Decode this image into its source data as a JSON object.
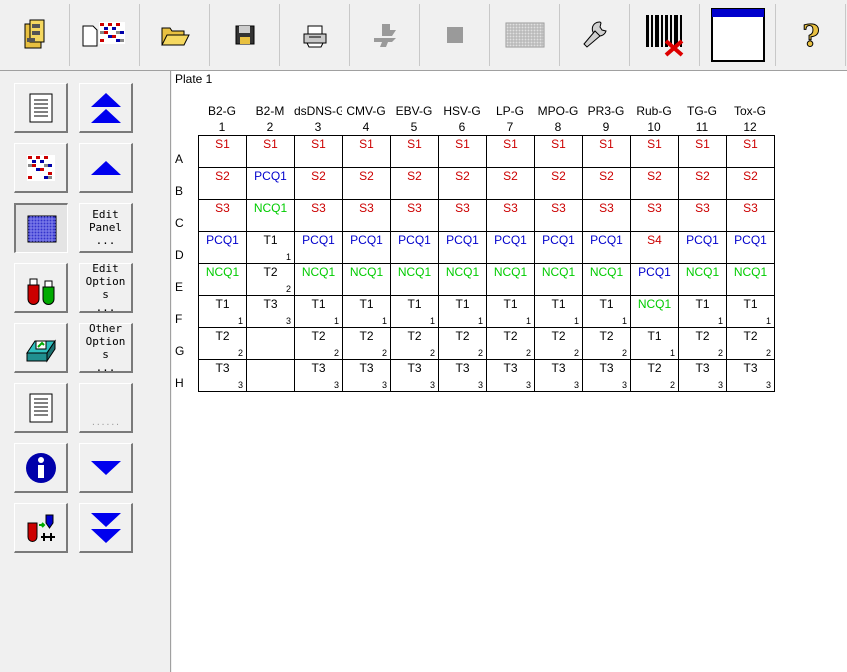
{
  "toolbar": {
    "buttons": [
      {
        "name": "open-database-icon"
      },
      {
        "name": "new-layout-icon"
      },
      {
        "name": "open-folder-icon"
      },
      {
        "name": "save-disk-icon"
      },
      {
        "name": "print-icon"
      },
      {
        "name": "transfer-icon",
        "disabled": true
      },
      {
        "name": "stop-icon",
        "disabled": true
      },
      {
        "name": "plate-grid-icon",
        "disabled": true
      },
      {
        "name": "wrench-icon"
      },
      {
        "name": "barcode-delete-icon"
      },
      {
        "name": "window-icon"
      },
      {
        "name": "help-icon"
      }
    ]
  },
  "left": {
    "edit_panel_label": "Edit\nPanel\n...",
    "edit_options_label": "Edit\nOption\ns\n...",
    "other_options_label": "Other\nOption\ns\n...",
    "disabled_label": "......"
  },
  "plate": {
    "title": "Plate 1",
    "columns": [
      {
        "name": "B2-G",
        "num": "1"
      },
      {
        "name": "B2-M",
        "num": "2"
      },
      {
        "name": "dsDNS-G",
        "num": "3"
      },
      {
        "name": "CMV-G",
        "num": "4"
      },
      {
        "name": "EBV-G",
        "num": "5"
      },
      {
        "name": "HSV-G",
        "num": "6"
      },
      {
        "name": "LP-G",
        "num": "7"
      },
      {
        "name": "MPO-G",
        "num": "8"
      },
      {
        "name": "PR3-G",
        "num": "9"
      },
      {
        "name": "Rub-G",
        "num": "10"
      },
      {
        "name": "TG-G",
        "num": "11"
      },
      {
        "name": "Tox-G",
        "num": "12"
      }
    ],
    "rows": [
      "A",
      "B",
      "C",
      "D",
      "E",
      "F",
      "G",
      "H"
    ],
    "colors": {
      "S": "#cc0000",
      "PCQ": "#0000cc",
      "NCQ": "#00cc00",
      "T": "#000000"
    },
    "wells": [
      [
        {
          "l": "S1",
          "t": "S"
        },
        {
          "l": "S1",
          "t": "S"
        },
        {
          "l": "S1",
          "t": "S"
        },
        {
          "l": "S1",
          "t": "S"
        },
        {
          "l": "S1",
          "t": "S"
        },
        {
          "l": "S1",
          "t": "S"
        },
        {
          "l": "S1",
          "t": "S"
        },
        {
          "l": "S1",
          "t": "S"
        },
        {
          "l": "S1",
          "t": "S"
        },
        {
          "l": "S1",
          "t": "S"
        },
        {
          "l": "S1",
          "t": "S"
        },
        {
          "l": "S1",
          "t": "S"
        }
      ],
      [
        {
          "l": "S2",
          "t": "S"
        },
        {
          "l": "PCQ1",
          "t": "PCQ"
        },
        {
          "l": "S2",
          "t": "S"
        },
        {
          "l": "S2",
          "t": "S"
        },
        {
          "l": "S2",
          "t": "S"
        },
        {
          "l": "S2",
          "t": "S"
        },
        {
          "l": "S2",
          "t": "S"
        },
        {
          "l": "S2",
          "t": "S"
        },
        {
          "l": "S2",
          "t": "S"
        },
        {
          "l": "S2",
          "t": "S"
        },
        {
          "l": "S2",
          "t": "S"
        },
        {
          "l": "S2",
          "t": "S"
        }
      ],
      [
        {
          "l": "S3",
          "t": "S"
        },
        {
          "l": "NCQ1",
          "t": "NCQ"
        },
        {
          "l": "S3",
          "t": "S"
        },
        {
          "l": "S3",
          "t": "S"
        },
        {
          "l": "S3",
          "t": "S"
        },
        {
          "l": "S3",
          "t": "S"
        },
        {
          "l": "S3",
          "t": "S"
        },
        {
          "l": "S3",
          "t": "S"
        },
        {
          "l": "S3",
          "t": "S"
        },
        {
          "l": "S3",
          "t": "S"
        },
        {
          "l": "S3",
          "t": "S"
        },
        {
          "l": "S3",
          "t": "S"
        }
      ],
      [
        {
          "l": "PCQ1",
          "t": "PCQ"
        },
        {
          "l": "T1",
          "t": "T",
          "r": "1"
        },
        {
          "l": "PCQ1",
          "t": "PCQ"
        },
        {
          "l": "PCQ1",
          "t": "PCQ"
        },
        {
          "l": "PCQ1",
          "t": "PCQ"
        },
        {
          "l": "PCQ1",
          "t": "PCQ"
        },
        {
          "l": "PCQ1",
          "t": "PCQ"
        },
        {
          "l": "PCQ1",
          "t": "PCQ"
        },
        {
          "l": "PCQ1",
          "t": "PCQ"
        },
        {
          "l": "S4",
          "t": "S"
        },
        {
          "l": "PCQ1",
          "t": "PCQ"
        },
        {
          "l": "PCQ1",
          "t": "PCQ"
        }
      ],
      [
        {
          "l": "NCQ1",
          "t": "NCQ"
        },
        {
          "l": "T2",
          "t": "T",
          "r": "2"
        },
        {
          "l": "NCQ1",
          "t": "NCQ"
        },
        {
          "l": "NCQ1",
          "t": "NCQ"
        },
        {
          "l": "NCQ1",
          "t": "NCQ"
        },
        {
          "l": "NCQ1",
          "t": "NCQ"
        },
        {
          "l": "NCQ1",
          "t": "NCQ"
        },
        {
          "l": "NCQ1",
          "t": "NCQ"
        },
        {
          "l": "NCQ1",
          "t": "NCQ"
        },
        {
          "l": "PCQ1",
          "t": "PCQ"
        },
        {
          "l": "NCQ1",
          "t": "NCQ"
        },
        {
          "l": "NCQ1",
          "t": "NCQ"
        }
      ],
      [
        {
          "l": "T1",
          "t": "T",
          "r": "1"
        },
        {
          "l": "T3",
          "t": "T",
          "r": "3"
        },
        {
          "l": "T1",
          "t": "T",
          "r": "1"
        },
        {
          "l": "T1",
          "t": "T",
          "r": "1"
        },
        {
          "l": "T1",
          "t": "T",
          "r": "1"
        },
        {
          "l": "T1",
          "t": "T",
          "r": "1"
        },
        {
          "l": "T1",
          "t": "T",
          "r": "1"
        },
        {
          "l": "T1",
          "t": "T",
          "r": "1"
        },
        {
          "l": "T1",
          "t": "T",
          "r": "1"
        },
        {
          "l": "NCQ1",
          "t": "NCQ"
        },
        {
          "l": "T1",
          "t": "T",
          "r": "1"
        },
        {
          "l": "T1",
          "t": "T",
          "r": "1"
        }
      ],
      [
        {
          "l": "T2",
          "t": "T",
          "r": "2"
        },
        {
          "l": "",
          "t": "T"
        },
        {
          "l": "T2",
          "t": "T",
          "r": "2"
        },
        {
          "l": "T2",
          "t": "T",
          "r": "2"
        },
        {
          "l": "T2",
          "t": "T",
          "r": "2"
        },
        {
          "l": "T2",
          "t": "T",
          "r": "2"
        },
        {
          "l": "T2",
          "t": "T",
          "r": "2"
        },
        {
          "l": "T2",
          "t": "T",
          "r": "2"
        },
        {
          "l": "T2",
          "t": "T",
          "r": "2"
        },
        {
          "l": "T1",
          "t": "T",
          "r": "1"
        },
        {
          "l": "T2",
          "t": "T",
          "r": "2"
        },
        {
          "l": "T2",
          "t": "T",
          "r": "2"
        }
      ],
      [
        {
          "l": "T3",
          "t": "T",
          "r": "3"
        },
        {
          "l": "",
          "t": "T"
        },
        {
          "l": "T3",
          "t": "T",
          "r": "3"
        },
        {
          "l": "T3",
          "t": "T",
          "r": "3"
        },
        {
          "l": "T3",
          "t": "T",
          "r": "3"
        },
        {
          "l": "T3",
          "t": "T",
          "r": "3"
        },
        {
          "l": "T3",
          "t": "T",
          "r": "3"
        },
        {
          "l": "T3",
          "t": "T",
          "r": "3"
        },
        {
          "l": "T3",
          "t": "T",
          "r": "3"
        },
        {
          "l": "T2",
          "t": "T",
          "r": "2"
        },
        {
          "l": "T3",
          "t": "T",
          "r": "3"
        },
        {
          "l": "T3",
          "t": "T",
          "r": "3"
        }
      ]
    ]
  }
}
